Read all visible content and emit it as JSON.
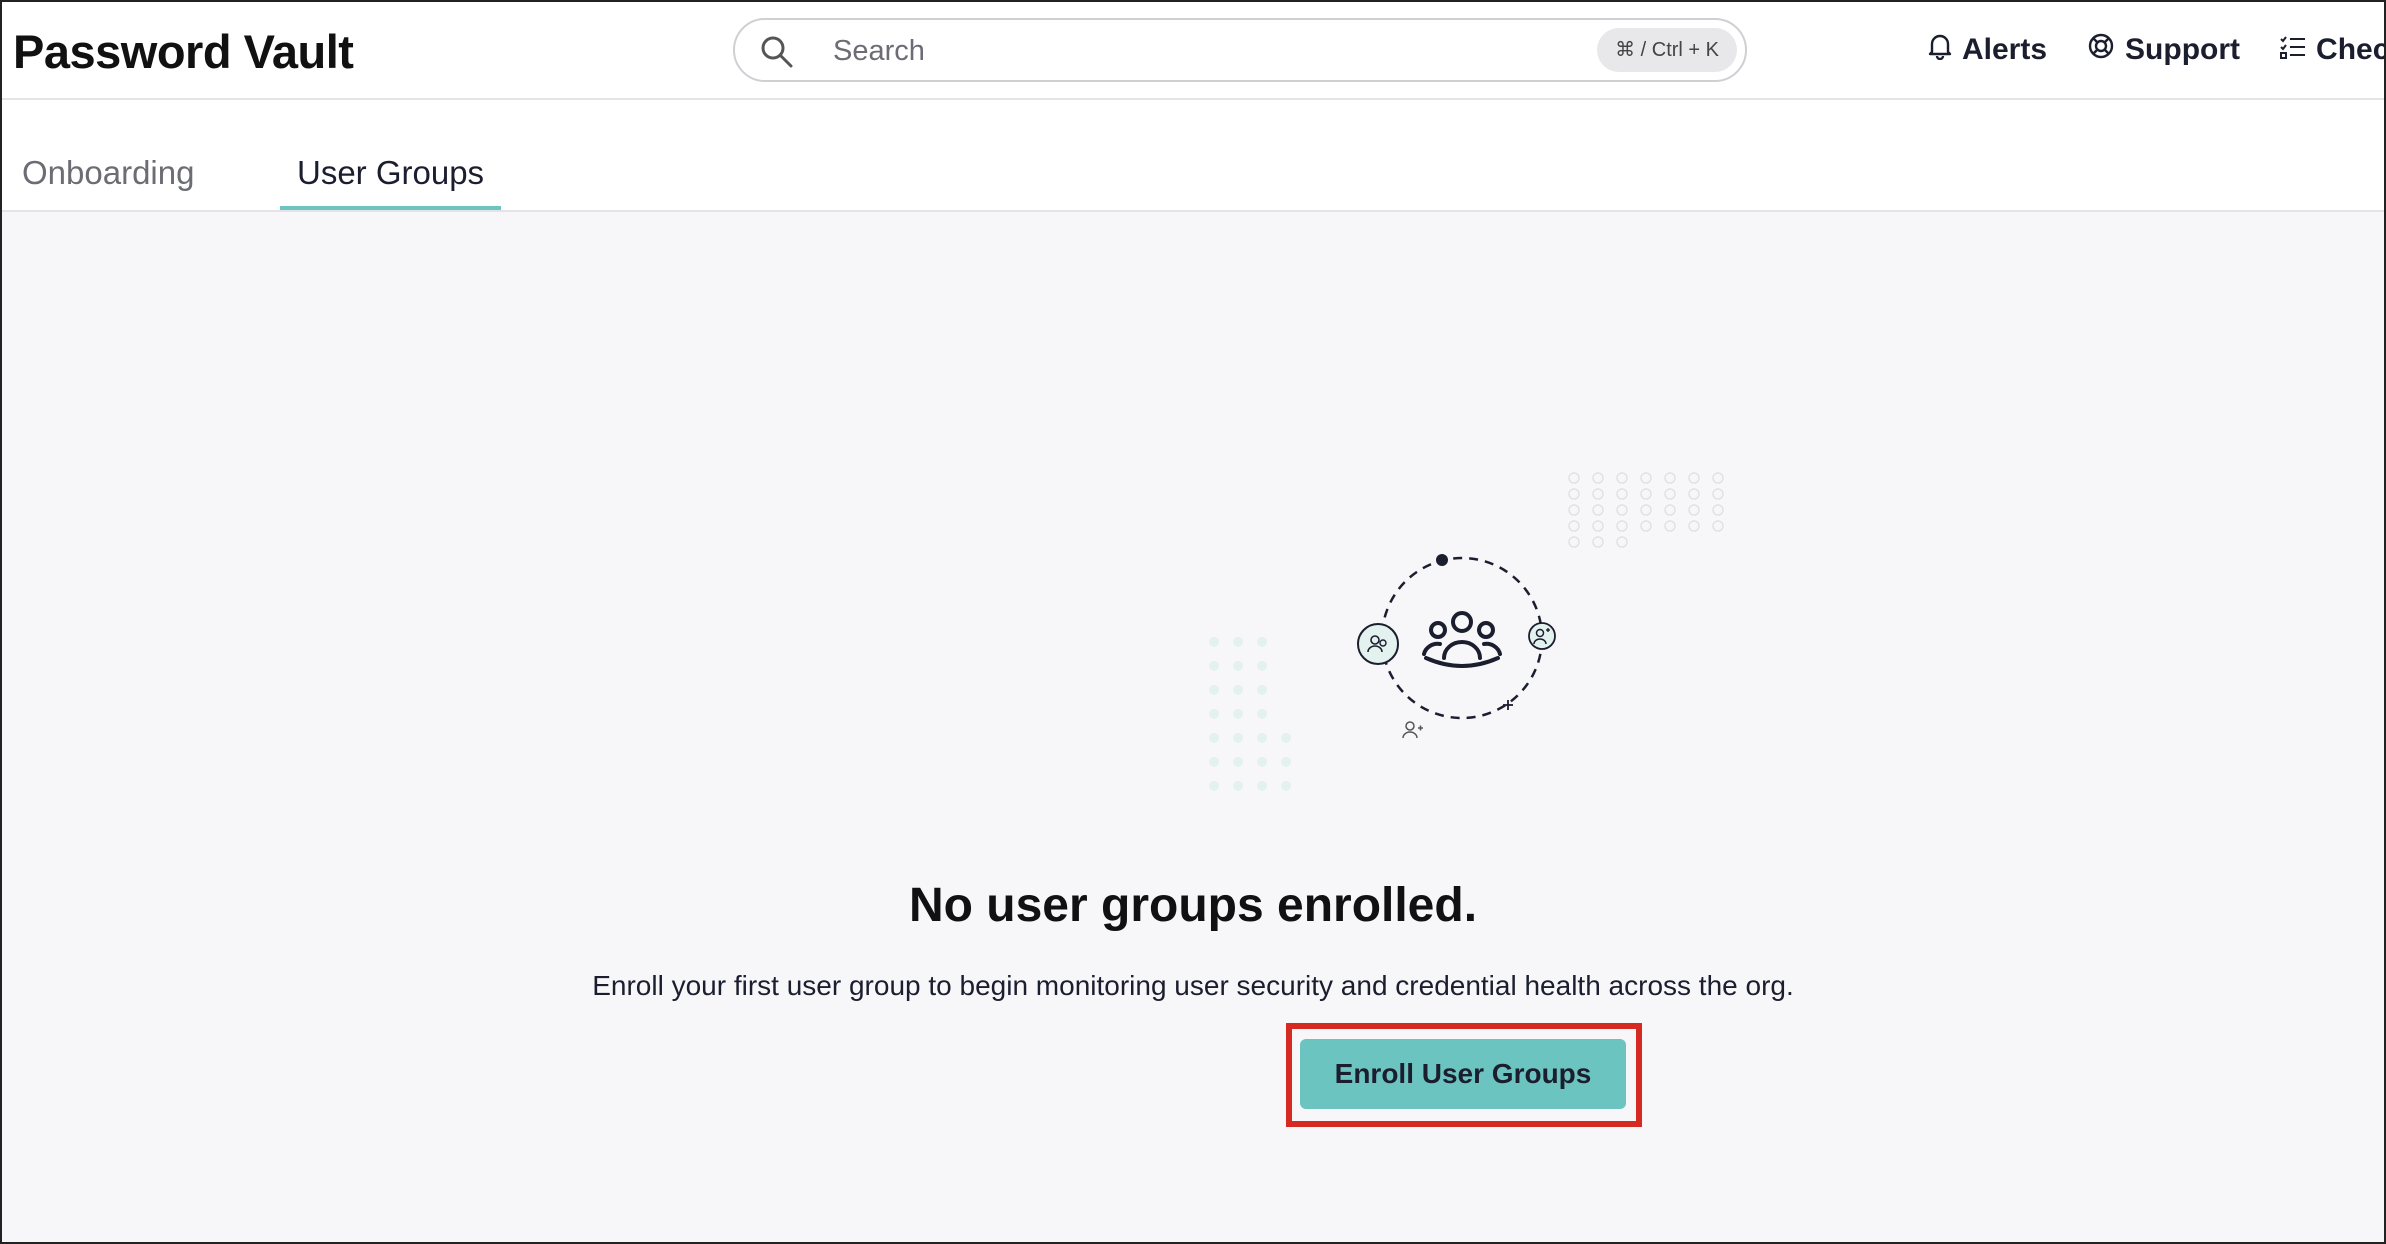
{
  "header": {
    "app_title": "Password Vault",
    "search": {
      "placeholder": "Search",
      "value": "",
      "shortcut": "⌘ / Ctrl + K"
    },
    "actions": [
      {
        "label": "Alerts",
        "icon": "bell-icon"
      },
      {
        "label": "Support",
        "icon": "lifebuoy-icon"
      },
      {
        "label": "Chec",
        "icon": "checklist-icon"
      }
    ]
  },
  "tabs": [
    {
      "label": "Onboarding",
      "active": false
    },
    {
      "label": "User Groups",
      "active": true
    }
  ],
  "empty_state": {
    "title": "No user groups enrolled.",
    "description": "Enroll your first user group to begin monitoring user security and credential health across the org.",
    "button_label": "Enroll User Groups"
  },
  "colors": {
    "accent": "#6cc4c1",
    "highlight": "#d42a22",
    "background": "#f7f6f9",
    "text": "#1b1e2e"
  }
}
